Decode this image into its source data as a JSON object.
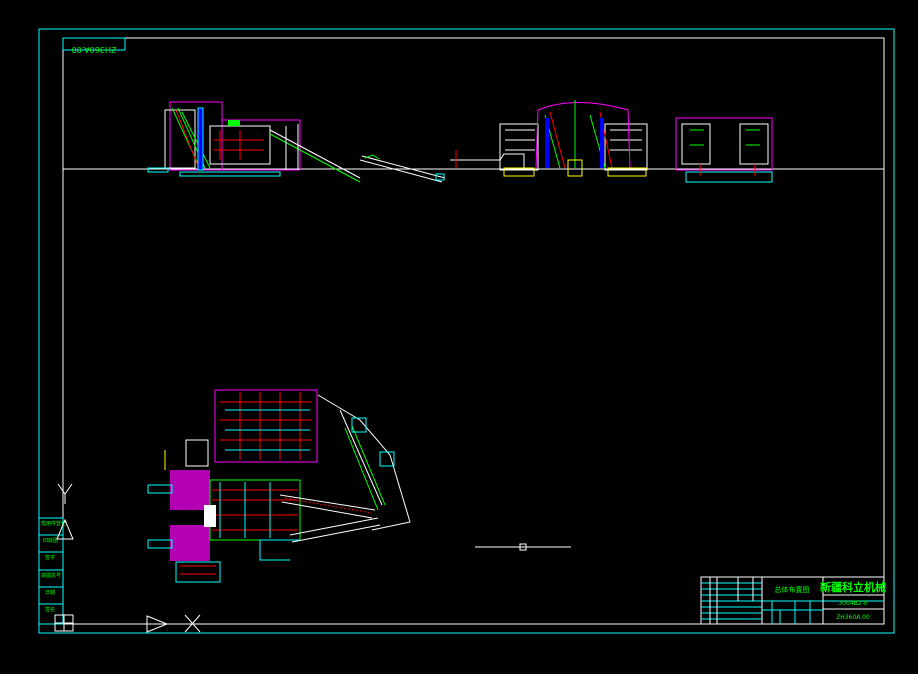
{
  "drawing": {
    "number_label": "ZH360A.00",
    "colors": {
      "background": "#000000",
      "frame": "#00ffff",
      "border": "#ffffff",
      "text": "#00ff00",
      "accent1": "#ff00ff",
      "accent2": "#ff0000",
      "accent3": "#0000ff",
      "ground": "#ffff00"
    }
  },
  "title_block": {
    "company": "新疆科立机械",
    "drawing_name": "总体布置图",
    "code": "3004B2-0",
    "drawing_number": "ZH360A.00"
  },
  "left_strip": {
    "labels": [
      "借用件登记",
      "旧底图",
      "签字",
      "底图总号",
      "日期",
      "签名"
    ]
  },
  "icons": [
    "ucs-y-axis-icon",
    "ucs-x-axis-icon",
    "ucs-origin-icon"
  ]
}
